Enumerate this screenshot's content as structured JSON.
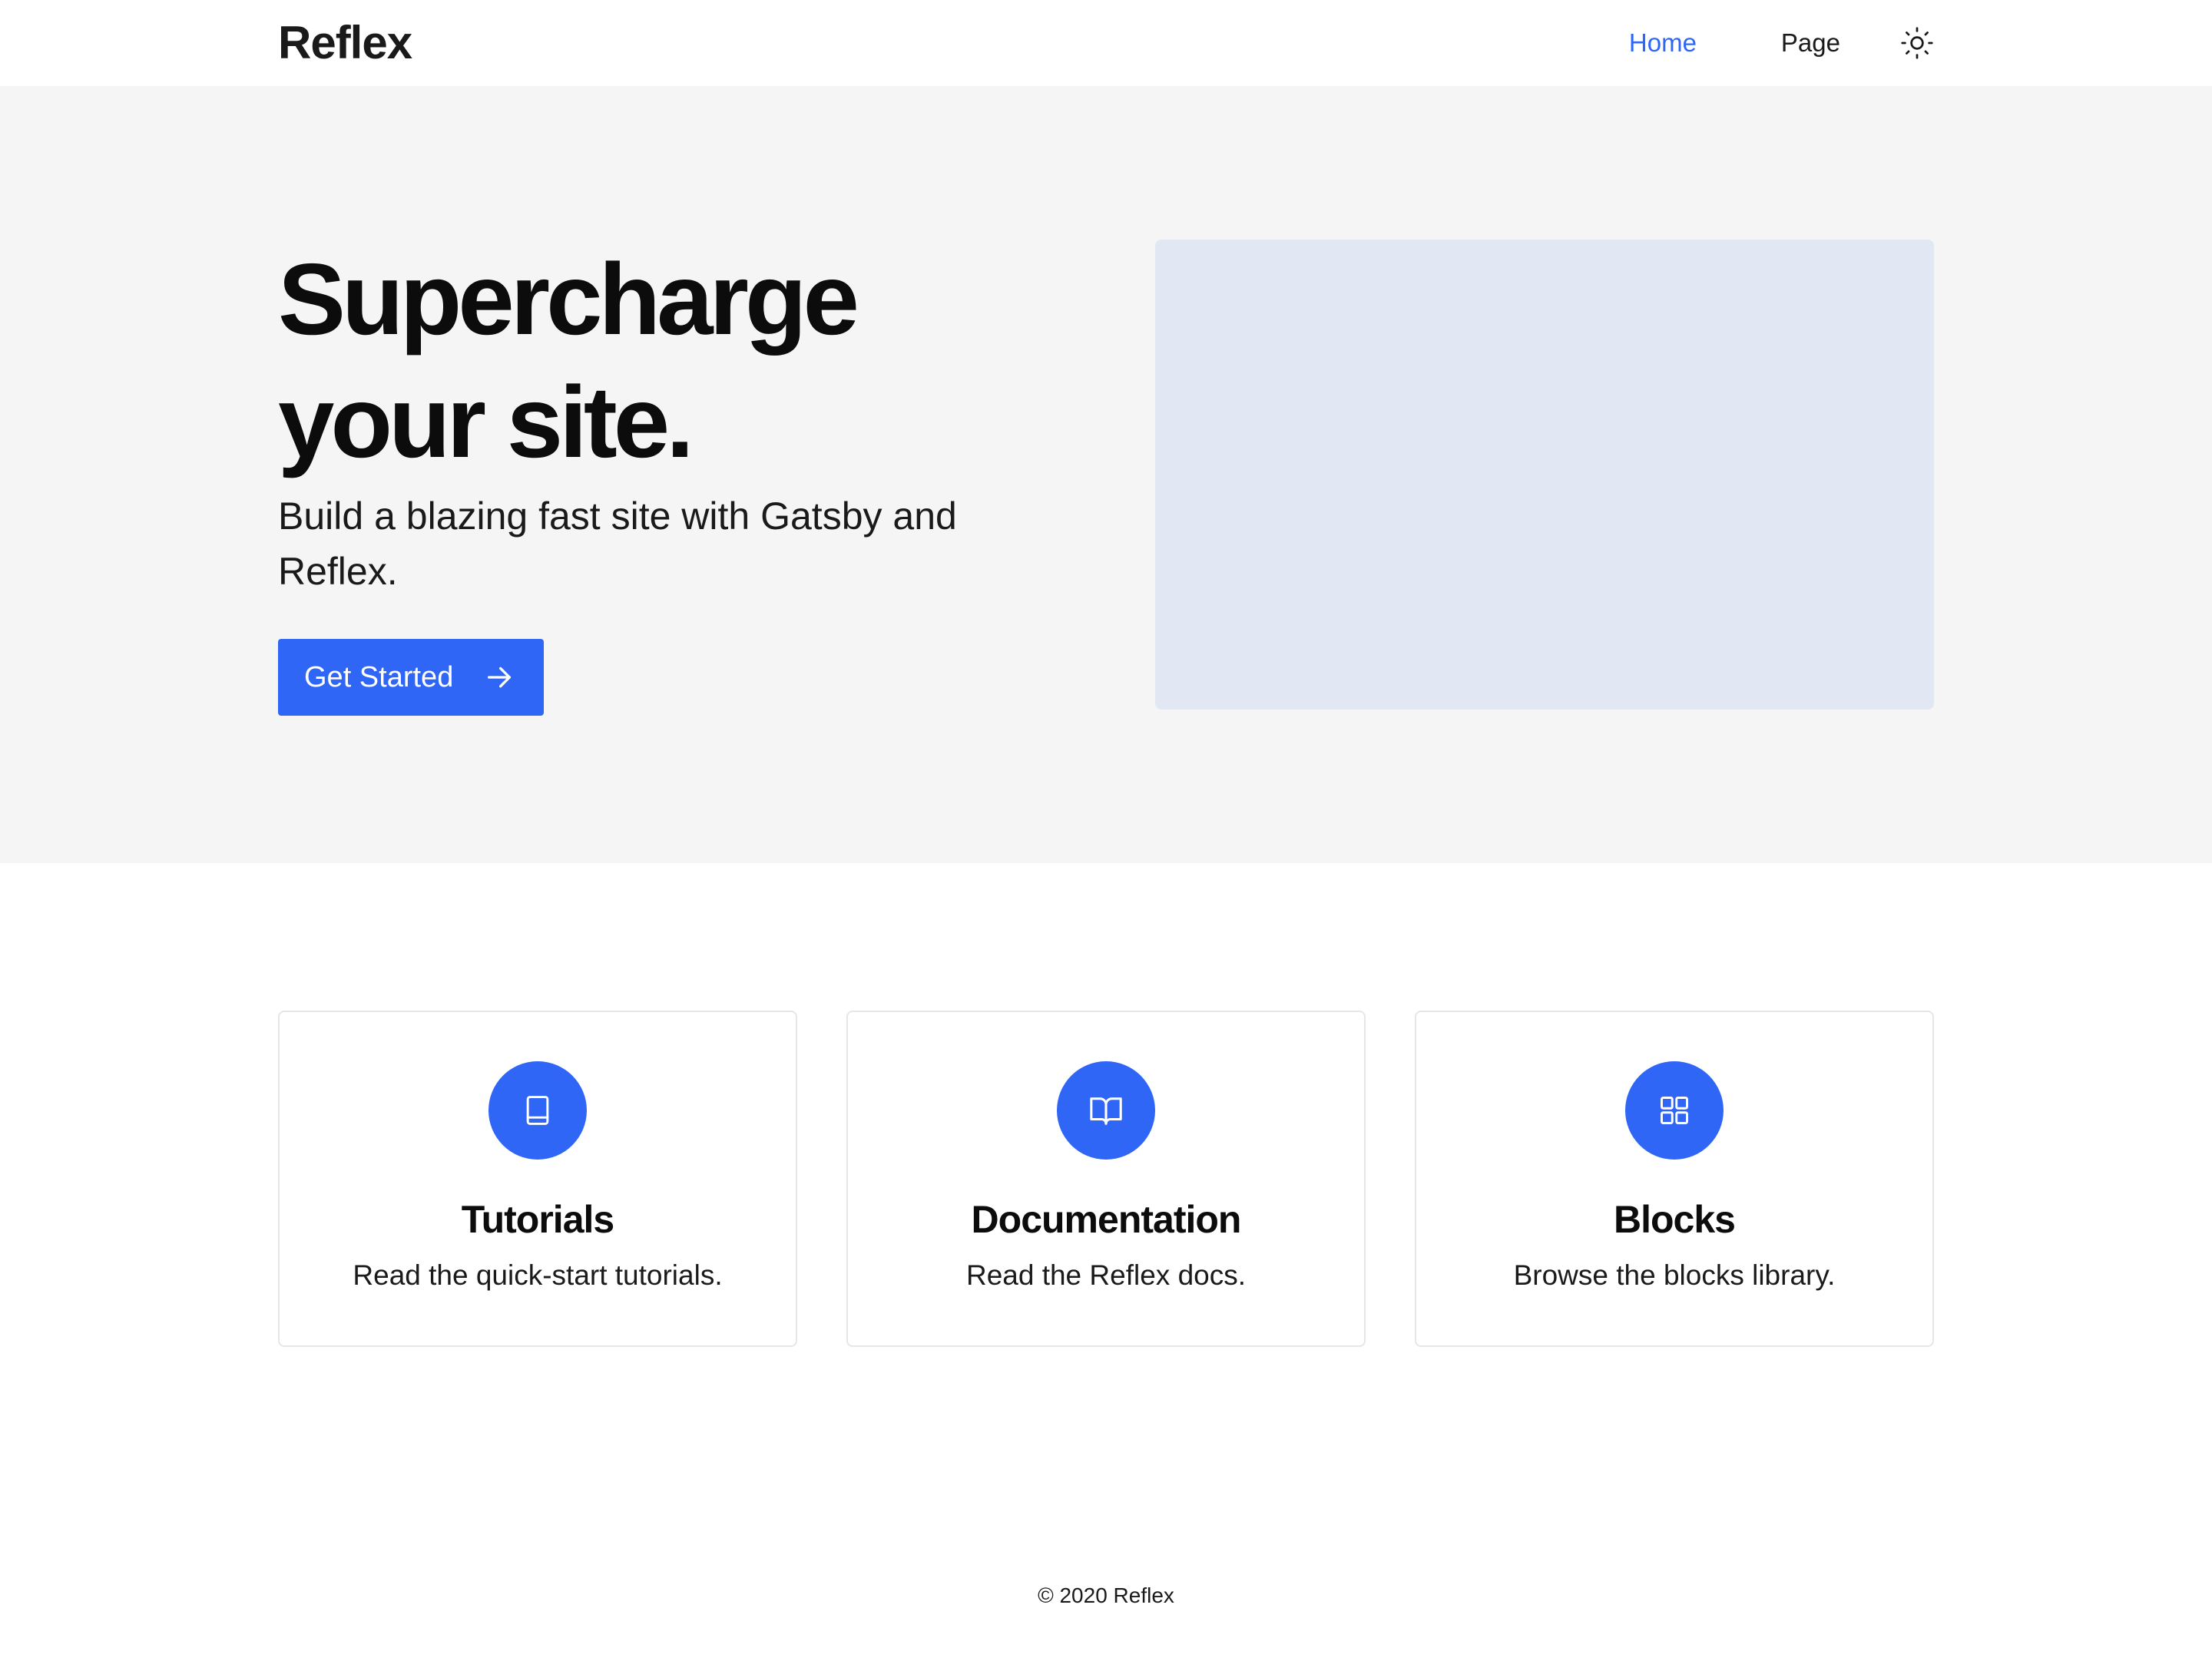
{
  "header": {
    "brand": "Reflex",
    "nav": [
      {
        "label": "Home",
        "active": true
      },
      {
        "label": "Page",
        "active": false
      }
    ],
    "theme_toggle_icon": "sun-icon"
  },
  "hero": {
    "title_line1": "Supercharge",
    "title_line2": "your site.",
    "subtitle": "Build a blazing fast site with Gatsby and Reflex.",
    "cta_label": "Get Started",
    "cta_icon": "arrow-right-icon",
    "image_placeholder_color": "#e2e8f3"
  },
  "features": [
    {
      "icon": "book-icon",
      "title": "Tutorials",
      "text": "Read the quick-start tutorials."
    },
    {
      "icon": "book-open-icon",
      "title": "Documentation",
      "text": "Read the Reflex docs."
    },
    {
      "icon": "grid-icon",
      "title": "Blocks",
      "text": "Browse the blocks library."
    }
  ],
  "footer": {
    "copyright": "© 2020 Reflex"
  },
  "colors": {
    "accent": "#2f66f6",
    "hero_bg": "#f5f5f5",
    "text": "#1a1a1a"
  }
}
